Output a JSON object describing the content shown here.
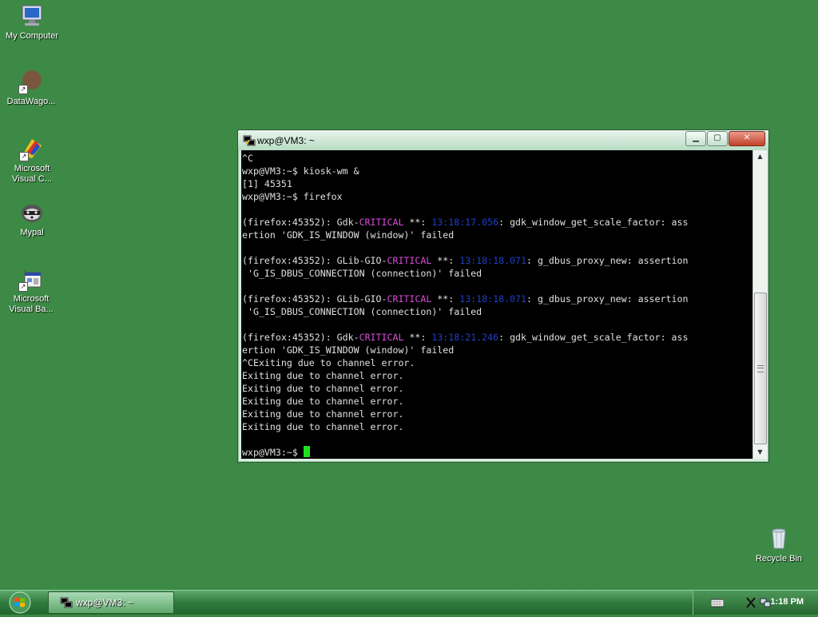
{
  "desktop": {
    "icons": [
      {
        "label": "My Computer",
        "icon": "my-computer-icon"
      },
      {
        "label": "DataWago...",
        "icon": "datawagon-icon"
      },
      {
        "label": "Microsoft\nVisual C...",
        "icon": "visual-c-icon"
      },
      {
        "label": "Mypal",
        "icon": "mypal-icon"
      },
      {
        "label": "Microsoft\nVisual Ba...",
        "icon": "visual-basic-icon"
      },
      {
        "label": "Recycle Bin",
        "icon": "recycle-bin-icon"
      }
    ]
  },
  "terminal": {
    "title": "wxp@VM3: ~",
    "lines": [
      "^C",
      "wxp@VM3:~$ kiosk-wm &",
      "[1] 45351",
      "wxp@VM3:~$ firefox",
      "",
      "(firefox:45352): Gdk-CRITICAL **: 13:18:17.056: gdk_window_get_scale_factor: ass",
      "ertion 'GDK_IS_WINDOW (window)' failed",
      "",
      "(firefox:45352): GLib-GIO-CRITICAL **: 13:18:18.071: g_dbus_proxy_new: assertion",
      " 'G_IS_DBUS_CONNECTION (connection)' failed",
      "",
      "(firefox:45352): GLib-GIO-CRITICAL **: 13:18:18.071: g_dbus_proxy_new: assertion",
      " 'G_IS_DBUS_CONNECTION (connection)' failed",
      "",
      "(firefox:45352): Gdk-CRITICAL **: 13:18:21.246: gdk_window_get_scale_factor: ass",
      "ertion 'GDK_IS_WINDOW (window)' failed",
      "^CExiting due to channel error.",
      "Exiting due to channel error.",
      "Exiting due to channel error.",
      "Exiting due to channel error.",
      "Exiting due to channel error.",
      "Exiting due to channel error.",
      "",
      "wxp@VM3:~$ "
    ],
    "colors": {
      "critical": "#d84bd8",
      "timestamp": "#1f3fc8",
      "cursor": "#1ee01e"
    }
  },
  "taskbar": {
    "task_label": "wxp@VM3: ~",
    "clock": "1:18 PM"
  }
}
